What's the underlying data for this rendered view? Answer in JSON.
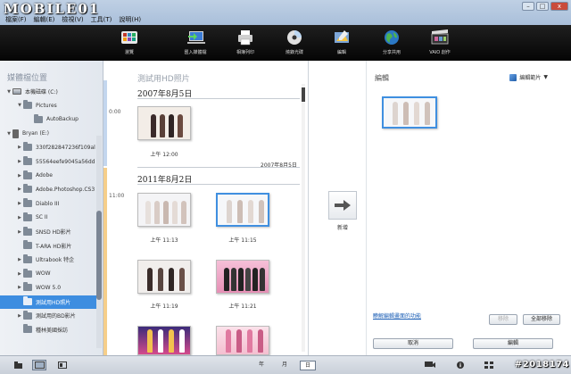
{
  "watermark": "MOBILE01",
  "copyright": "#2018174",
  "window_controls": [
    "–",
    "□",
    "x"
  ],
  "menu": [
    "檔案(F)",
    "編輯(E)",
    "檢視(V)",
    "工具(T)",
    "說明(H)"
  ],
  "toolbar": [
    {
      "label": "瀏覽",
      "icon": "browse-icon"
    },
    {
      "label": "匯入媒體檔",
      "icon": "import-icon"
    },
    {
      "label": "相簿列印",
      "icon": "print-icon"
    },
    {
      "label": "燒錄光碟",
      "icon": "disc-icon"
    },
    {
      "label": "編輯",
      "icon": "edit-icon"
    },
    {
      "label": "分享共用",
      "icon": "share-globe-icon"
    },
    {
      "label": "VAIO 創作",
      "icon": "film-icon"
    }
  ],
  "sidebar": {
    "title": "媒體檔位置",
    "items": [
      {
        "label": "本機磁碟 (C:)",
        "indent": 0,
        "twisty": "▼",
        "icon": "drive-icon"
      },
      {
        "label": "Pictures",
        "indent": 1,
        "twisty": "▼",
        "icon": "folder-icon"
      },
      {
        "label": "AutoBackup",
        "indent": 2,
        "twisty": "",
        "icon": "folder-icon"
      },
      {
        "label": "Bryan (E:)",
        "indent": 0,
        "twisty": "▼",
        "icon": "phone-icon"
      },
      {
        "label": "330f282847236f109al",
        "indent": 1,
        "twisty": "▶",
        "icon": "folder-icon"
      },
      {
        "label": "55564eefe9045a56dd",
        "indent": 1,
        "twisty": "▶",
        "icon": "folder-icon"
      },
      {
        "label": "Adobe",
        "indent": 1,
        "twisty": "▶",
        "icon": "folder-icon"
      },
      {
        "label": "Adobe.Photoshop.CS3",
        "indent": 1,
        "twisty": "▶",
        "icon": "folder-icon"
      },
      {
        "label": "Diablo III",
        "indent": 1,
        "twisty": "▶",
        "icon": "folder-icon"
      },
      {
        "label": "SC II",
        "indent": 1,
        "twisty": "▶",
        "icon": "folder-icon"
      },
      {
        "label": "SNSD HD影片",
        "indent": 1,
        "twisty": "▶",
        "icon": "folder-icon"
      },
      {
        "label": "T-ARA HD影片",
        "indent": 1,
        "twisty": "",
        "icon": "folder-icon"
      },
      {
        "label": "Ultrabook 特企",
        "indent": 1,
        "twisty": "▶",
        "icon": "folder-icon"
      },
      {
        "label": "WOW",
        "indent": 1,
        "twisty": "▶",
        "icon": "folder-icon"
      },
      {
        "label": "WOW 5.0",
        "indent": 1,
        "twisty": "▶",
        "icon": "folder-icon"
      },
      {
        "label": "測試用HD照片",
        "indent": 1,
        "twisty": "",
        "icon": "folder-icon",
        "selected": true
      },
      {
        "label": "測試用的BD影片",
        "indent": 1,
        "twisty": "▶",
        "icon": "folder-icon"
      },
      {
        "label": "種林美國採訪",
        "indent": 1,
        "twisty": "",
        "icon": "folder-icon"
      }
    ]
  },
  "middle": {
    "title": "測試用HD照片",
    "groups": [
      {
        "date": "2007年8月5日",
        "time": "0:00",
        "footer": "2007年8月5日",
        "items": [
          {
            "caption": "上午 12:00"
          }
        ]
      },
      {
        "date": "2011年8月2日",
        "time": "11:00",
        "items": [
          {
            "caption": "上午 11:13"
          },
          {
            "caption": "上午 11:15",
            "selected": true
          },
          {
            "caption": "上午 11:19"
          },
          {
            "caption": "上午 11:21"
          },
          {
            "caption": ""
          },
          {
            "caption": ""
          }
        ]
      }
    ]
  },
  "right": {
    "title": "編輯",
    "album_select": "編輯範片",
    "add_label": "新增",
    "link": "瞭解編輯畫面的功能",
    "remove_button": "移除",
    "remove_all_button": "全部移除",
    "cancel_button": "取消",
    "edit_button": "編輯"
  },
  "statusbar": {
    "periods": [
      "年",
      "月",
      "日"
    ],
    "active_period": "日"
  }
}
